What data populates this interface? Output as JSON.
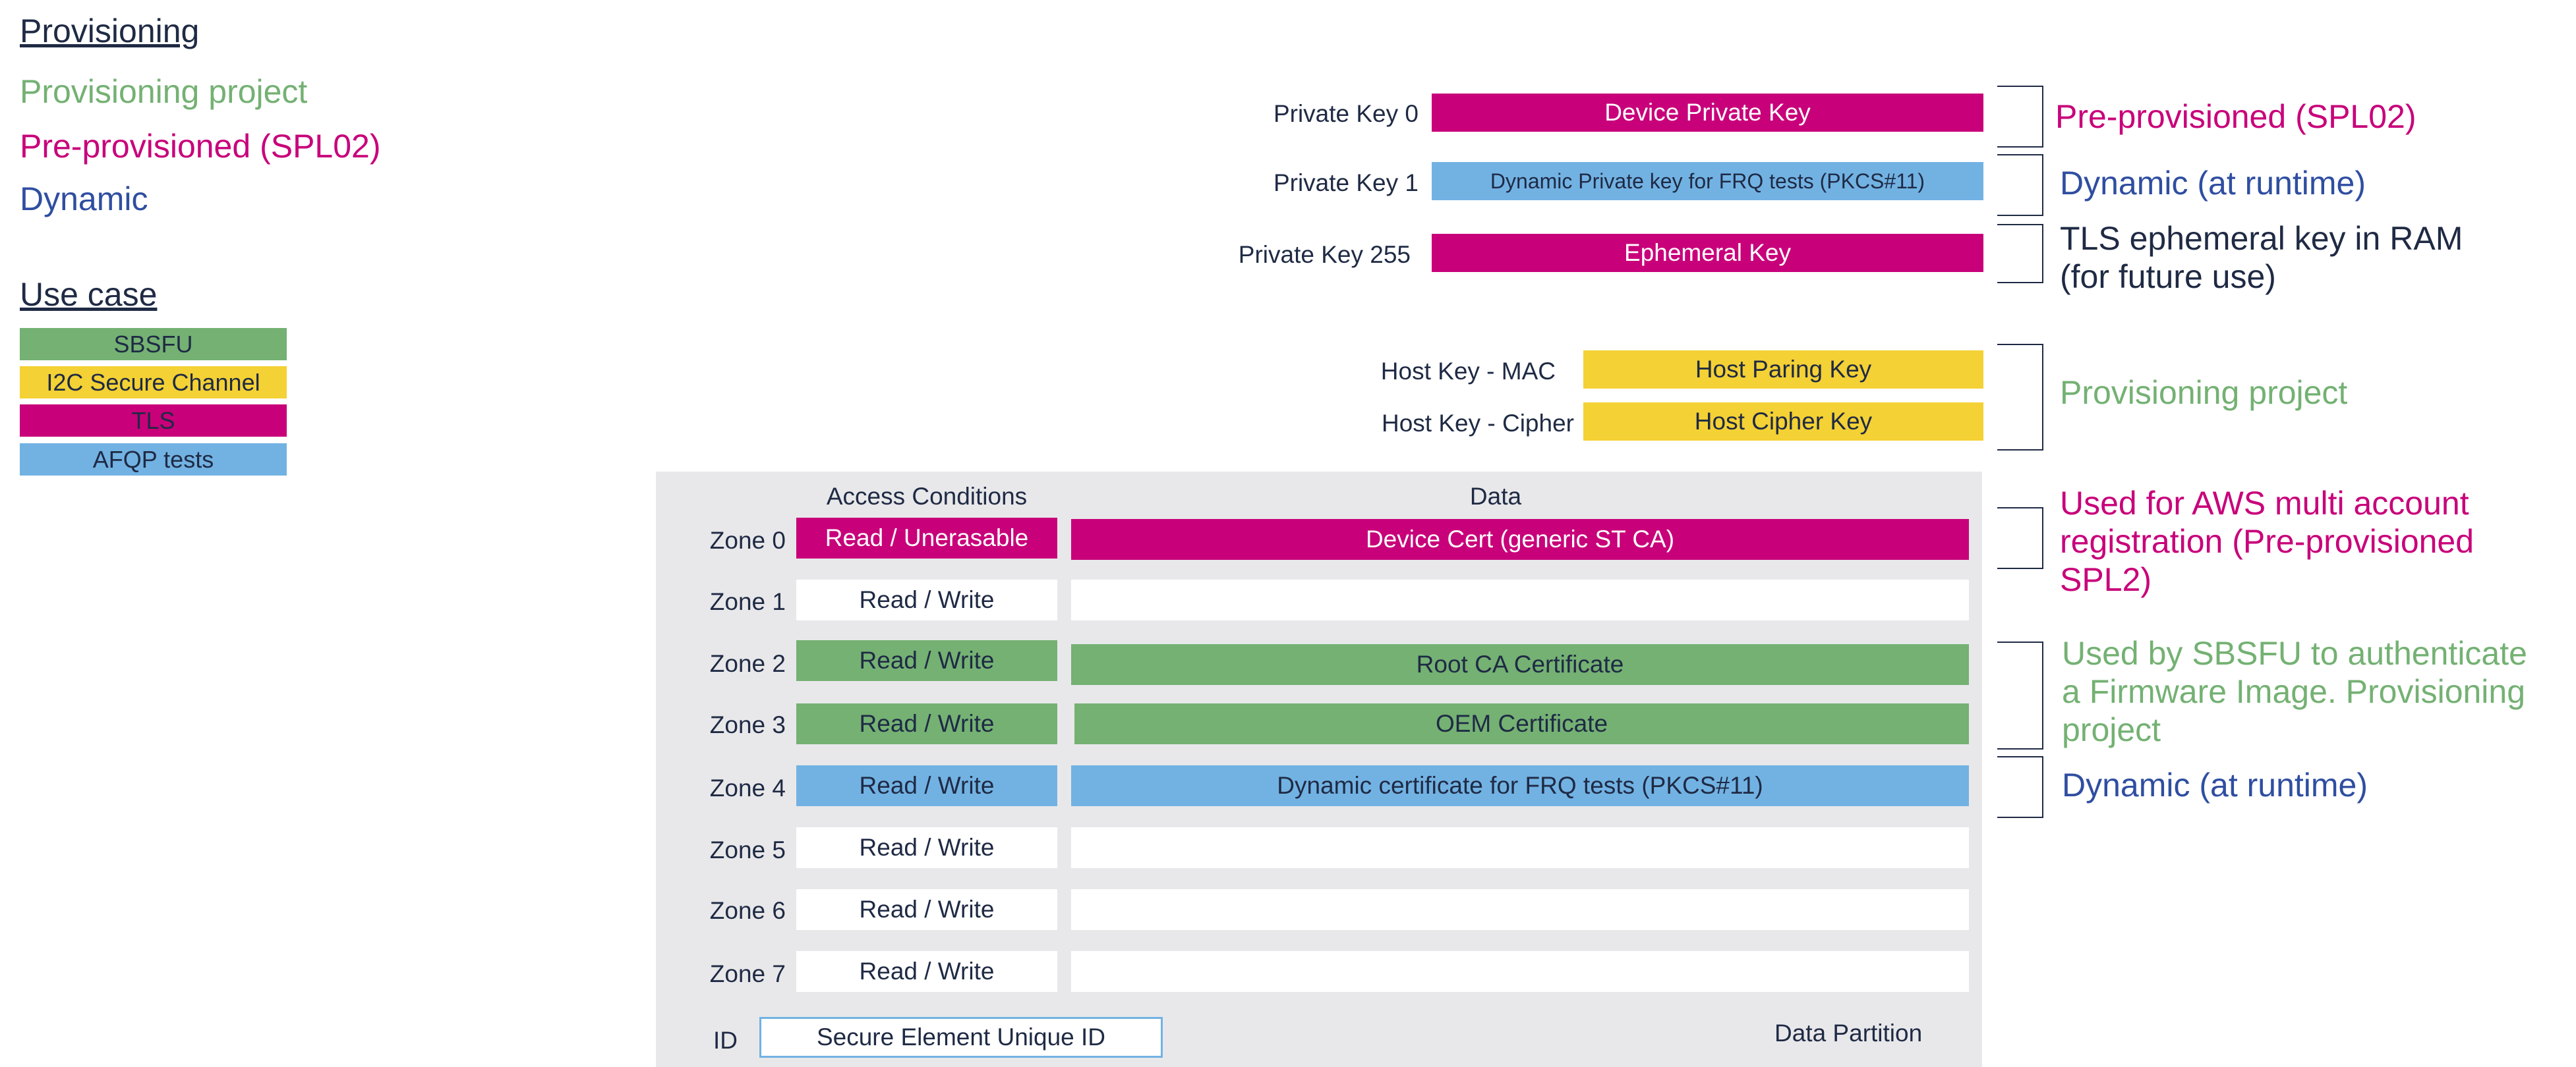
{
  "legend": {
    "provisioning_title": "Provisioning",
    "items": [
      {
        "label": "Provisioning project",
        "color": "#74b173"
      },
      {
        "label": "Pre-provisioned (SPL02)",
        "color": "#c8007a"
      },
      {
        "label": "Dynamic",
        "color": "#2f4ea1"
      }
    ],
    "use_case_title": "Use case",
    "use_cases": [
      {
        "label": "SBSFU",
        "color": "#74b173"
      },
      {
        "label": "I2C Secure Channel",
        "color": "#f4d134"
      },
      {
        "label": "TLS",
        "color": "#c8007a"
      },
      {
        "label": "AFQP tests",
        "color": "#72b2e3"
      }
    ]
  },
  "keys": [
    {
      "label": "Private Key 0",
      "value": "Device Private Key",
      "color": "pink"
    },
    {
      "label": "Private Key 1",
      "value": "Dynamic Private key for FRQ tests (PKCS#11)",
      "color": "blue"
    },
    {
      "label": "Private Key 255",
      "value": "Ephemeral Key",
      "color": "pink"
    }
  ],
  "host_keys": [
    {
      "label": "Host Key - MAC",
      "value": "Host Paring Key",
      "color": "yellow"
    },
    {
      "label": "Host Key - Cipher",
      "value": "Host Cipher Key",
      "color": "yellow"
    }
  ],
  "partition": {
    "access_header": "Access Conditions",
    "data_header": "Data",
    "zones": [
      {
        "label": "Zone 0",
        "access": "Read / Unerasable",
        "data": "Device Cert (generic ST CA)",
        "color": "pink"
      },
      {
        "label": "Zone 1",
        "access": "Read / Write",
        "data": "",
        "color": "white"
      },
      {
        "label": "Zone 2",
        "access": "Read / Write",
        "data": "Root CA Certificate",
        "color": "green"
      },
      {
        "label": "Zone 3",
        "access": "Read / Write",
        "data": "OEM Certificate",
        "color": "green"
      },
      {
        "label": "Zone 4",
        "access": "Read / Write",
        "data": "Dynamic certificate for FRQ tests (PKCS#11)",
        "color": "blue"
      },
      {
        "label": "Zone 5",
        "access": "Read / Write",
        "data": "",
        "color": "white"
      },
      {
        "label": "Zone 6",
        "access": "Read / Write",
        "data": "",
        "color": "white"
      },
      {
        "label": "Zone 7",
        "access": "Read / Write",
        "data": "",
        "color": "white"
      }
    ],
    "id_label": "ID",
    "id_value": "Secure Element Unique ID",
    "partition_label": "Data Partition"
  },
  "annotations": {
    "key0": "Pre-provisioned (SPL02)",
    "key1": "Dynamic (at runtime)",
    "key255_line1": "TLS ephemeral key in RAM",
    "key255_line2": "(for future use)",
    "host": "Provisioning project",
    "zone0_line1": "Used for AWS multi account",
    "zone0_line2": "registration (Pre-provisioned",
    "zone0_line3": "SPL2)",
    "zone23_line1": "Used by SBSFU to authenticate",
    "zone23_line2": "a Firmware Image. Provisioning",
    "zone23_line3": "project",
    "zone4": "Dynamic (at runtime)"
  }
}
